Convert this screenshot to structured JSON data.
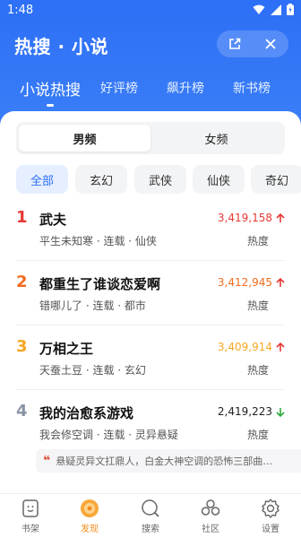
{
  "status_bar": {
    "time": "1:48"
  },
  "header": {
    "title": "热搜 · 小说",
    "rank_tabs": [
      {
        "label": "小说热搜",
        "active": true
      },
      {
        "label": "好评榜",
        "active": false
      },
      {
        "label": "飙升榜",
        "active": false
      },
      {
        "label": "新书榜",
        "active": false
      }
    ]
  },
  "gender_tabs": [
    {
      "label": "男频",
      "active": true
    },
    {
      "label": "女频",
      "active": false
    }
  ],
  "genres": [
    {
      "label": "全部",
      "active": true
    },
    {
      "label": "玄幻",
      "active": false
    },
    {
      "label": "武侠",
      "active": false
    },
    {
      "label": "仙侠",
      "active": false
    },
    {
      "label": "奇幻",
      "active": false
    }
  ],
  "books": [
    {
      "rank": "1",
      "title": "武夫",
      "meta": "平生未知寒 · 连载 · 仙侠",
      "heat": "3,419,158",
      "trend": "up",
      "heat_label": "热度",
      "rank_color": "#e53935",
      "heat_color": "#e53935"
    },
    {
      "rank": "2",
      "title": "都重生了谁谈恋爱啊",
      "meta": "错哪儿了 · 连载 · 都市",
      "heat": "3,412,945",
      "trend": "up",
      "heat_label": "热度",
      "rank_color": "#f26b1d",
      "heat_color": "#f26b1d"
    },
    {
      "rank": "3",
      "title": "万相之王",
      "meta": "天蚕土豆 · 连载 · 玄幻",
      "heat": "3,409,914",
      "trend": "up",
      "heat_label": "热度",
      "rank_color": "#f5a623",
      "heat_color": "#f5a623"
    },
    {
      "rank": "4",
      "title": "我的治愈系游戏",
      "meta": "我会修空调 · 连载 · 灵异悬疑",
      "heat": "2,419,223",
      "trend": "down",
      "heat_label": "热度",
      "rank_color": "#8a93a6",
      "heat_color": "#222222"
    }
  ],
  "quote": {
    "text": "悬疑灵异文扛鼎人，白金大神空调的恐怖三部曲…"
  },
  "bottom_nav": [
    {
      "label": "书架",
      "icon": "bookshelf-icon",
      "active": false
    },
    {
      "label": "发现",
      "icon": "discover-icon",
      "active": true
    },
    {
      "label": "搜索",
      "icon": "search-icon",
      "active": false
    },
    {
      "label": "社区",
      "icon": "community-icon",
      "active": false
    },
    {
      "label": "设置",
      "icon": "settings-icon",
      "active": false
    }
  ],
  "colors": {
    "brand_blue": "#2d6ff6",
    "up": "#e53935",
    "down": "#2eaa3f",
    "active_nav": "#f28c1a"
  }
}
